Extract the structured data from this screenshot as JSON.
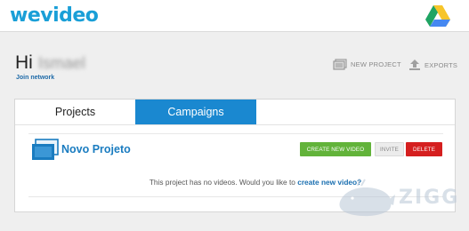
{
  "app": {
    "logo_we": "we",
    "logo_video": "video"
  },
  "user": {
    "greeting": "Hi",
    "name": "Ismael",
    "join_network": "Join network"
  },
  "toolbar": {
    "new_project": "NEW PROJECT",
    "exports": "EXPORTS"
  },
  "tabs": [
    {
      "label": "Projects",
      "active": true
    },
    {
      "label": "Campaigns",
      "active": false
    }
  ],
  "project": {
    "title": "Novo Projeto",
    "create_button": "CREATE NEW VIDEO",
    "invite_button": "INVITE",
    "delete_button": "DELETE",
    "empty_text": "This project has no videos. Would you like to",
    "empty_link": "create new video?"
  },
  "colors": {
    "brand": "#1a9fd7",
    "tab_active_bg": "#1a88d0",
    "create": "#62b33a",
    "delete": "#d51f1f"
  },
  "icons": [
    "google-drive-icon",
    "new-project-icon",
    "exports-icon",
    "project-folder-icon"
  ]
}
